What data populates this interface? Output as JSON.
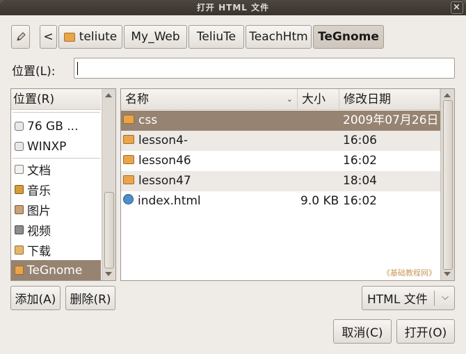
{
  "window": {
    "title": "打开 HTML 文件",
    "close_glyph": "×"
  },
  "toolbar": {
    "edit_icon": "pencil-icon",
    "back_glyph": "<",
    "breadcrumbs": [
      {
        "label": "teliute",
        "icon": "folder-icon"
      },
      {
        "label": "My_Web"
      },
      {
        "label": "TeliuTe"
      },
      {
        "label": "TeachHtm"
      },
      {
        "label": "TeGnome"
      }
    ]
  },
  "location": {
    "label": "位置(L):",
    "value": ""
  },
  "places": {
    "header": "位置(R)",
    "items": [
      {
        "label": "76 GB ...",
        "icon": "drive-icon"
      },
      {
        "label": "WINXP",
        "icon": "drive-icon"
      },
      {
        "label": "文档",
        "icon": "documents-icon"
      },
      {
        "label": "音乐",
        "icon": "music-icon"
      },
      {
        "label": "图片",
        "icon": "pictures-icon"
      },
      {
        "label": "视频",
        "icon": "videos-icon"
      },
      {
        "label": "下载",
        "icon": "downloads-icon"
      },
      {
        "label": "TeGnome",
        "icon": "folder-icon",
        "selected": true
      }
    ],
    "add_label": "添加(A)",
    "remove_label": "删除(R)"
  },
  "files": {
    "columns": {
      "name": "名称",
      "size": "大小",
      "modified": "修改日期"
    },
    "rows": [
      {
        "name": "css",
        "size": "",
        "modified": "2009年07月26日",
        "icon": "folder-icon",
        "selected": true
      },
      {
        "name": "lesson4-",
        "size": "",
        "modified": "16:06",
        "icon": "folder-icon"
      },
      {
        "name": "lesson46",
        "size": "",
        "modified": "16:02",
        "icon": "folder-icon"
      },
      {
        "name": "lesson47",
        "size": "",
        "modified": "18:04",
        "icon": "folder-icon"
      },
      {
        "name": "index.html",
        "size": "9.0 KB",
        "modified": "16:02",
        "icon": "html-file-icon"
      }
    ],
    "watermark": "《基础教程网》"
  },
  "filter": {
    "value": "HTML 文件"
  },
  "actions": {
    "cancel_label": "取消(C)",
    "open_label": "打开(O)"
  }
}
